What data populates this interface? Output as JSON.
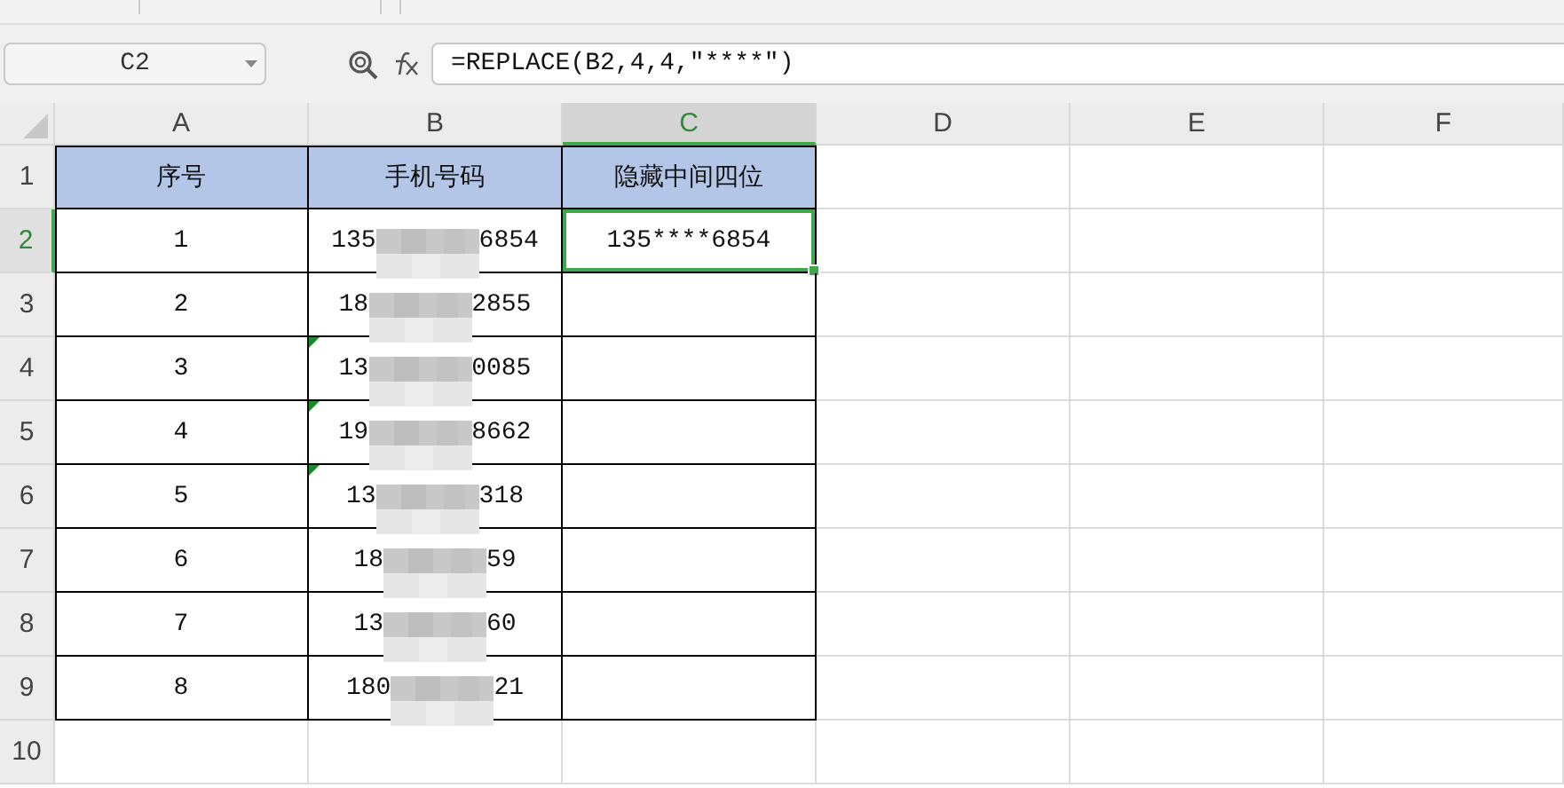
{
  "name_box": "C2",
  "formula": "=REPLACE(B2,4,4,\"****\")",
  "columns": [
    {
      "label": "A",
      "selected": false
    },
    {
      "label": "B",
      "selected": false
    },
    {
      "label": "C",
      "selected": true
    },
    {
      "label": "D",
      "selected": false
    },
    {
      "label": "E",
      "selected": false
    },
    {
      "label": "F",
      "selected": false
    }
  ],
  "rows": [
    {
      "number": "1",
      "selected": false,
      "kind": "header",
      "cells": [
        {
          "kind": "text",
          "text": "序号",
          "selected": false
        },
        {
          "kind": "text",
          "text": "手机号码",
          "selected": false
        },
        {
          "kind": "text",
          "text": "隐藏中间四位",
          "selected": false
        }
      ]
    },
    {
      "number": "2",
      "selected": true,
      "kind": "data",
      "cells": [
        {
          "kind": "text",
          "text": "1",
          "selected": false
        },
        {
          "kind": "phone",
          "start": "135",
          "end": "6854",
          "flag": false,
          "selected": false
        },
        {
          "kind": "text",
          "text": "135****6854",
          "selected": true
        }
      ]
    },
    {
      "number": "3",
      "selected": false,
      "kind": "data",
      "cells": [
        {
          "kind": "text",
          "text": "2",
          "selected": false
        },
        {
          "kind": "phone",
          "start": "18",
          "end": "2855",
          "flag": false,
          "selected": false
        },
        {
          "kind": "text",
          "selected": false
        }
      ]
    },
    {
      "number": "4",
      "selected": false,
      "kind": "data",
      "cells": [
        {
          "kind": "text",
          "text": "3",
          "selected": false
        },
        {
          "kind": "phone",
          "start": "13",
          "end": "0085",
          "flag": true,
          "selected": false
        },
        {
          "kind": "text",
          "selected": false
        }
      ]
    },
    {
      "number": "5",
      "selected": false,
      "kind": "data",
      "cells": [
        {
          "kind": "text",
          "text": "4",
          "selected": false
        },
        {
          "kind": "phone",
          "start": "19",
          "end": "8662",
          "flag": true,
          "selected": false
        },
        {
          "kind": "text",
          "selected": false
        }
      ]
    },
    {
      "number": "6",
      "selected": false,
      "kind": "data",
      "cells": [
        {
          "kind": "text",
          "text": "5",
          "selected": false
        },
        {
          "kind": "phone",
          "start": "13",
          "end": "318",
          "flag": true,
          "selected": false
        },
        {
          "kind": "text",
          "selected": false
        }
      ]
    },
    {
      "number": "7",
      "selected": false,
      "kind": "data",
      "cells": [
        {
          "kind": "text",
          "text": "6",
          "selected": false
        },
        {
          "kind": "phone",
          "start": "18",
          "end": "59",
          "flag": false,
          "selected": false
        },
        {
          "kind": "text",
          "selected": false
        }
      ]
    },
    {
      "number": "8",
      "selected": false,
      "kind": "data",
      "cells": [
        {
          "kind": "text",
          "text": "7",
          "selected": false
        },
        {
          "kind": "phone",
          "start": "13",
          "end": "60",
          "flag": false,
          "selected": false
        },
        {
          "kind": "text",
          "selected": false
        }
      ]
    },
    {
      "number": "9",
      "selected": false,
      "kind": "data",
      "cells": [
        {
          "kind": "text",
          "text": "8",
          "selected": false
        },
        {
          "kind": "phone",
          "start": "180",
          "end": "21",
          "flag": false,
          "selected": false
        },
        {
          "kind": "text",
          "selected": false
        }
      ]
    },
    {
      "number": "10",
      "selected": false,
      "kind": "data"
    }
  ]
}
